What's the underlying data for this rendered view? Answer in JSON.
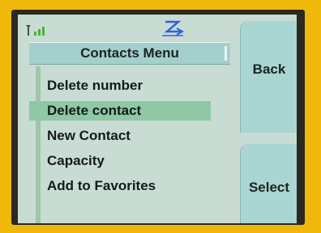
{
  "status_bar": {
    "signal_icon": "signal-strength-icon",
    "network_icon": "network-z-icon",
    "signal_color": "#4caf3a",
    "network_color": "#2f64d8"
  },
  "menu": {
    "title": "Contacts Menu",
    "selected_index": 1,
    "items": [
      {
        "label": "Delete number"
      },
      {
        "label": "Delete contact"
      },
      {
        "label": "New Contact"
      },
      {
        "label": "Capacity"
      },
      {
        "label": "Add to Favorites"
      }
    ]
  },
  "softkeys": {
    "back_label": "Back",
    "select_label": "Select"
  },
  "colors": {
    "frame": "#f0b80a",
    "screen_bg": "#c9dcd4",
    "highlight": "#8ec8a4",
    "softkey_bg": "#a9d5d2"
  }
}
